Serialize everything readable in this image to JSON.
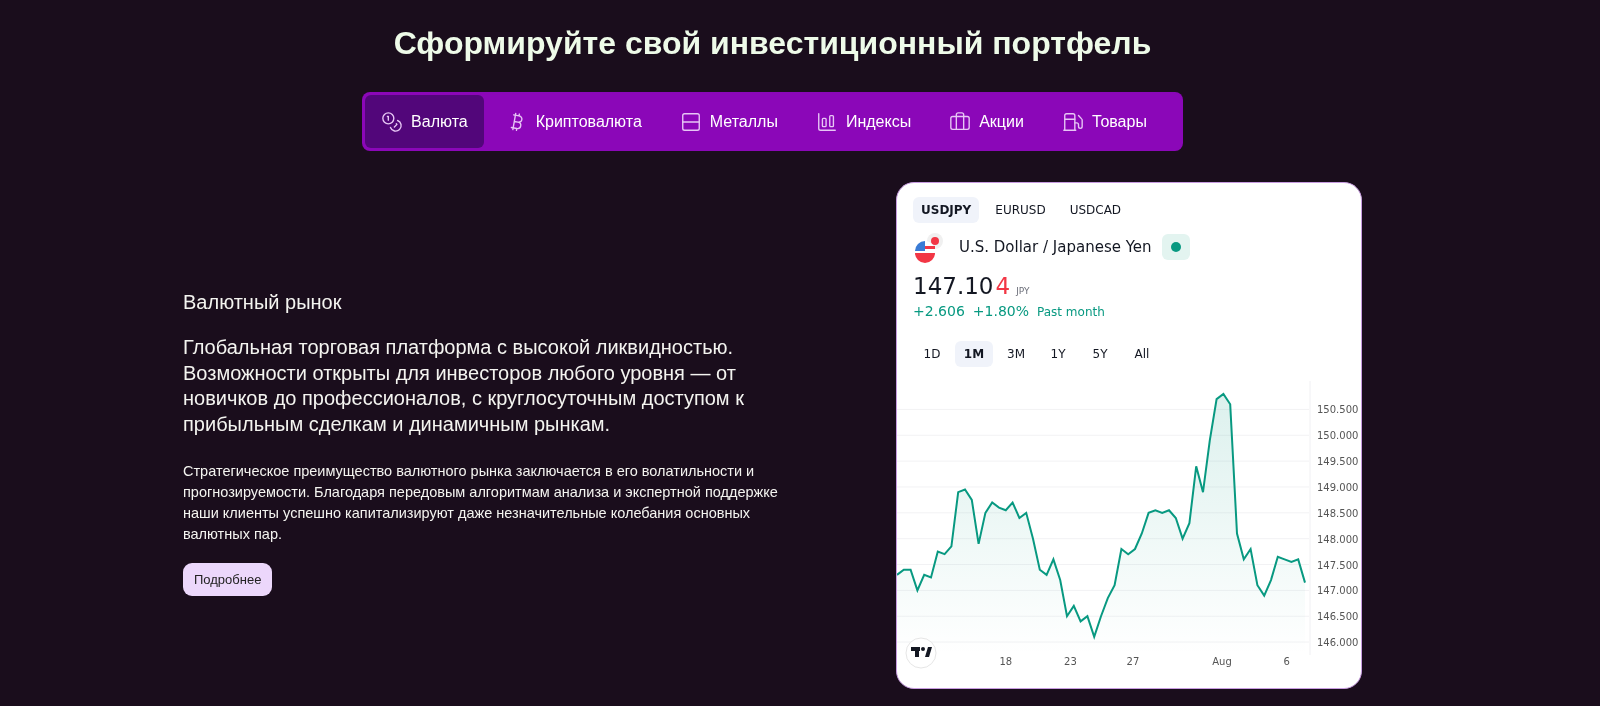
{
  "title": "Сформируйте свой инвестиционный портфель",
  "tabs": [
    {
      "label": "Валюта",
      "selected": true
    },
    {
      "label": "Криптовалюта",
      "selected": false
    },
    {
      "label": "Металлы",
      "selected": false
    },
    {
      "label": "Индексы",
      "selected": false
    },
    {
      "label": "Акции",
      "selected": false
    },
    {
      "label": "Товары",
      "selected": false
    }
  ],
  "section": {
    "heading": "Валютный рынок",
    "lead": "Глобальная торговая платформа с высокой ликвидностью. Возможности открыты для инвесторов любого уровня — от новичков до профессионалов, с круглосуточным доступом к прибыльным сделкам и динамичным рынкам.",
    "body": "Стратегическое преимущество валютного рынка заключается в его волатильности и прогнозируемости. Благодаря передовым алгоритмам анализа и экспертной поддержке наши клиенты успешно капитализируют даже незначительные колебания основных валютных пар.",
    "button": "Подробнее"
  },
  "widget": {
    "symbols": [
      {
        "label": "USDJPY",
        "selected": true
      },
      {
        "label": "EURUSD",
        "selected": false
      },
      {
        "label": "USDCAD",
        "selected": false
      }
    ],
    "name": "U.S. Dollar / Japanese Yen",
    "market_open": true,
    "price": "147.10",
    "price_tail": "4",
    "currency": "JPY",
    "change": "+2.606",
    "change_percent": "+1.80%",
    "period": "Past month",
    "ranges": [
      {
        "label": "1D",
        "selected": false
      },
      {
        "label": "1M",
        "selected": true
      },
      {
        "label": "3M",
        "selected": false
      },
      {
        "label": "1Y",
        "selected": false
      },
      {
        "label": "5Y",
        "selected": false
      },
      {
        "label": "All",
        "selected": false
      }
    ],
    "x_axis_labels": [
      "18",
      "23",
      "27",
      "Aug",
      "6"
    ],
    "chart_data": {
      "type": "area",
      "grid": true,
      "ylim": [
        145.75,
        151.05
      ],
      "yticks": [
        {
          "value": 146,
          "label": "146.000"
        },
        {
          "value": 146.5,
          "label": "146.500"
        },
        {
          "value": 147,
          "label": "147.000"
        },
        {
          "value": 147.5,
          "label": "147.500"
        },
        {
          "value": 148,
          "label": "148.000"
        },
        {
          "value": 148.5,
          "label": "148.500"
        },
        {
          "value": 149,
          "label": "149.000"
        },
        {
          "value": 149.5,
          "label": "149.500"
        },
        {
          "value": 150,
          "label": "150.000"
        },
        {
          "value": 150.5,
          "label": "150.500"
        }
      ],
      "series": [
        {
          "color": "#089981",
          "values": [
            147.3,
            147.4,
            147.4,
            147.0,
            147.3,
            147.25,
            147.75,
            147.7,
            147.85,
            148.9,
            148.95,
            148.75,
            147.9,
            148.5,
            148.7,
            148.6,
            148.55,
            148.7,
            148.4,
            148.5,
            148.0,
            147.4,
            147.3,
            147.6,
            147.2,
            146.5,
            146.7,
            146.4,
            146.5,
            146.1,
            146.5,
            146.85,
            147.1,
            147.8,
            147.7,
            147.8,
            148.1,
            148.5,
            148.55,
            148.5,
            148.55,
            148.4,
            148.0,
            148.3,
            149.4,
            148.9,
            149.9,
            150.7,
            150.8,
            150.6,
            148.1,
            147.6,
            147.8,
            147.1,
            146.9,
            147.2,
            147.65,
            147.6,
            147.55,
            147.6,
            147.15
          ]
        }
      ]
    }
  }
}
